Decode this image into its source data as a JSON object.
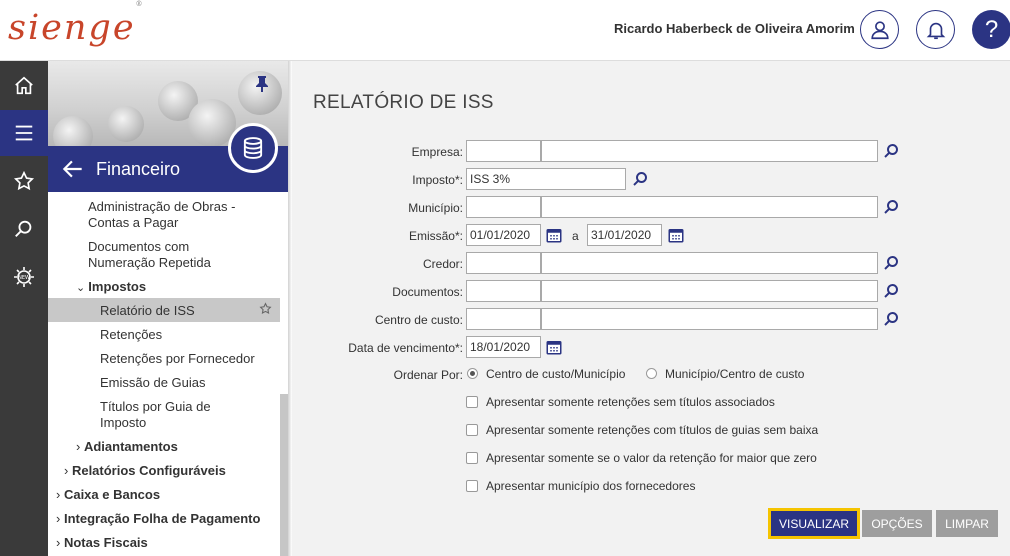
{
  "header": {
    "logo": "sienge",
    "logo_mark": "®",
    "user_name": "Ricardo Haberbeck de Oliveira Amorim",
    "help_label": "?",
    "icons": [
      "user-icon",
      "bell-icon",
      "help-icon"
    ]
  },
  "rail": {
    "items": [
      "home-icon",
      "menu-icon",
      "star-icon",
      "search-icon",
      "gear-new-icon"
    ],
    "active": "menu-icon"
  },
  "panel": {
    "title": "Financeiro",
    "items": [
      {
        "label": "Administração de Obras -",
        "label2": "Contas a Pagar"
      },
      {
        "label": "Documentos com",
        "label2": "Numeração Repetida"
      },
      {
        "label": "Impostos"
      },
      {
        "label": "Relatório de ISS"
      },
      {
        "label": "Retenções"
      },
      {
        "label": "Retenções por Fornecedor"
      },
      {
        "label": "Emissão de Guias"
      },
      {
        "label": "Títulos por Guia de",
        "label2": "Imposto"
      },
      {
        "label": "Adiantamentos"
      },
      {
        "label": "Relatórios Configuráveis"
      },
      {
        "label": "Caixa e Bancos"
      },
      {
        "label": "Integração Folha de Pagamento"
      },
      {
        "label": "Notas Fiscais"
      }
    ]
  },
  "form": {
    "title": "RELATÓRIO DE ISS",
    "labels": {
      "empresa": "Empresa:",
      "imposto": "Imposto*:",
      "municipio": "Município:",
      "emissao": "Emissão*:",
      "credor": "Credor:",
      "documentos": "Documentos:",
      "centro_custo": "Centro de custo:",
      "vencimento": "Data de vencimento*:",
      "ordenar": "Ordenar Por:"
    },
    "values": {
      "imposto": "ISS 3%",
      "emissao_de": "01/01/2020",
      "emissao_ate": "31/01/2020",
      "vencimento": "18/01/2020"
    },
    "range_sep": "a",
    "order_options": [
      "Centro de custo/Município",
      "Município/Centro de custo"
    ],
    "order_selected": 0,
    "checkboxes": [
      "Apresentar somente retenções sem títulos associados",
      "Apresentar somente retenções com títulos de guias sem baixa",
      "Apresentar somente se o valor da retenção for maior que zero",
      "Apresentar município dos fornecedores"
    ],
    "buttons": {
      "visualizar": "VISUALIZAR",
      "opcoes": "OPÇÕES",
      "limpar": "LIMPAR"
    }
  },
  "colors": {
    "brand": "#2b3483",
    "logo": "#c8452a",
    "rail": "#3a3a3a",
    "button_gray": "#9e9e9e",
    "focus_border": "#f5c400"
  }
}
